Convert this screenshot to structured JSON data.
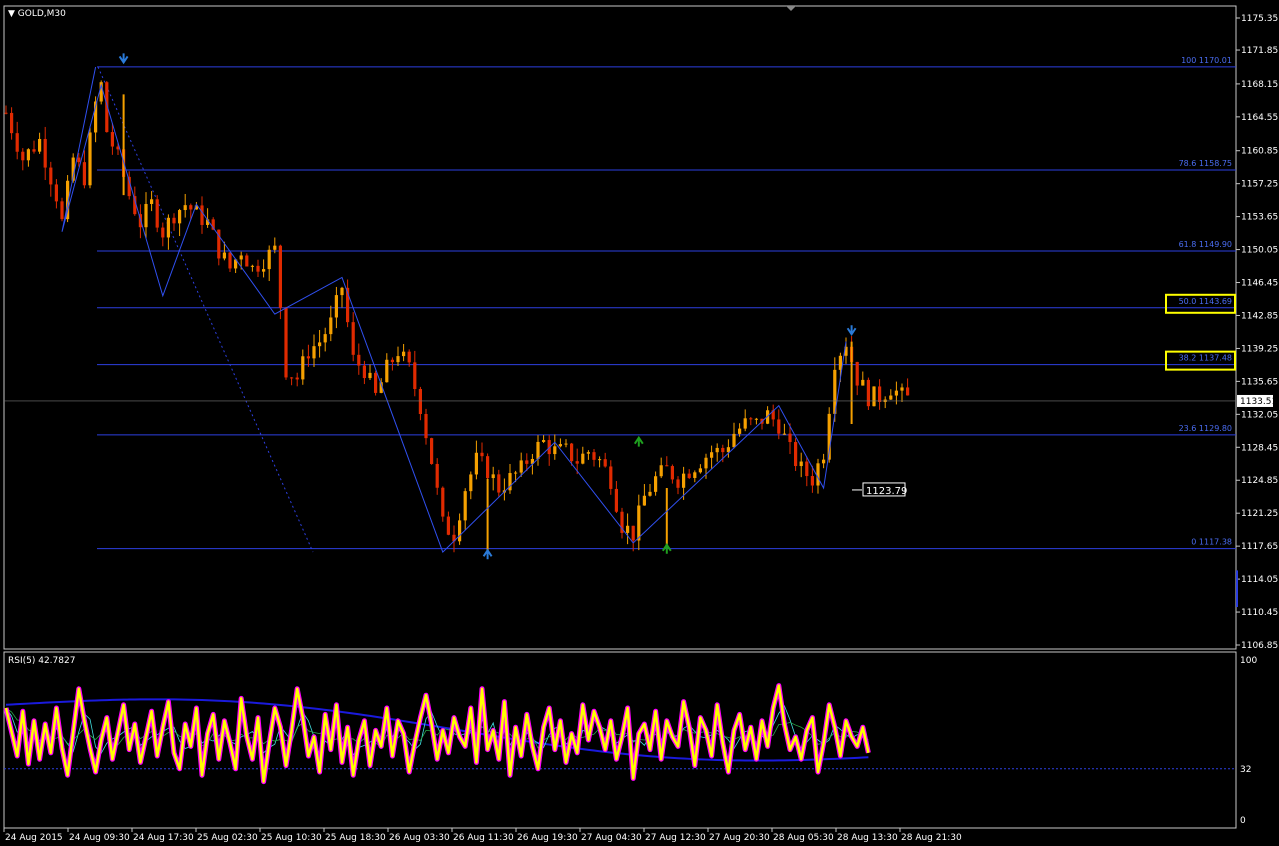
{
  "header": {
    "symbol_label": "GOLD,M30",
    "menu_glyph": "▼"
  },
  "colors": {
    "background": "#000000",
    "axis": "#c8c8c8",
    "grid": "#3a3a3a",
    "fib": "#2d3fe0",
    "fib_text": "#4a6cf0",
    "candle_up": "#f5a000",
    "candle_down": "#e02a00",
    "zigzag": "#3050f0",
    "rsi": "#ffff00",
    "rsi_glow": "#ff00ff",
    "ma_slow": "#1a1adc",
    "highlight_box": "#ffff00"
  },
  "price_axis": {
    "ticks": [
      "1175.35",
      "1171.85",
      "1168.15",
      "1164.55",
      "1160.85",
      "1157.25",
      "1153.65",
      "1150.05",
      "1146.45",
      "1142.85",
      "1139.25",
      "1135.65",
      "1132.05",
      "1128.45",
      "1124.85",
      "1121.25",
      "1117.65",
      "1114.05",
      "1110.45",
      "1106.85"
    ],
    "current_price": "1133.51",
    "marked_price": "1123.79"
  },
  "fibonacci": [
    {
      "label": "100 1170.01",
      "level": 1170.01,
      "highlight": false
    },
    {
      "label": "78.6 1158.75",
      "level": 1158.75,
      "highlight": false
    },
    {
      "label": "61.8 1149.90",
      "level": 1149.9,
      "highlight": false
    },
    {
      "label": "50.0 1143.69",
      "level": 1143.69,
      "highlight": true
    },
    {
      "label": "38.2 1137.48",
      "level": 1137.48,
      "highlight": true
    },
    {
      "label": "23.6 1129.80",
      "level": 1129.8,
      "highlight": false
    },
    {
      "label": "0 1117.38",
      "level": 1117.38,
      "highlight": false
    }
  ],
  "rsi": {
    "title": "RSI(5) 42.7827",
    "ticks": [
      "100",
      "32",
      "0"
    ],
    "level": 32
  },
  "time_axis": {
    "ticks": [
      "24 Aug 2015",
      "24 Aug 09:30",
      "24 Aug 17:30",
      "25 Aug 02:30",
      "25 Aug 10:30",
      "25 Aug 18:30",
      "26 Aug 03:30",
      "26 Aug 11:30",
      "26 Aug 19:30",
      "27 Aug 04:30",
      "27 Aug 12:30",
      "27 Aug 20:30",
      "28 Aug 05:30",
      "28 Aug 13:30",
      "28 Aug 21:30"
    ]
  },
  "chart_data": {
    "type": "candlestick",
    "title": "GOLD,M30",
    "ylim": [
      1106.0,
      1177.0
    ],
    "close_path": [
      [
        0,
        1165
      ],
      [
        3,
        1160
      ],
      [
        6,
        1162
      ],
      [
        9,
        1156
      ],
      [
        10,
        1153
      ],
      [
        12,
        1160
      ],
      [
        14,
        1158
      ],
      [
        16,
        1166
      ],
      [
        17,
        1168
      ],
      [
        18,
        1163
      ],
      [
        20,
        1160
      ],
      [
        22,
        1156
      ],
      [
        24,
        1153
      ],
      [
        26,
        1155
      ],
      [
        28,
        1152
      ],
      [
        30,
        1154
      ],
      [
        32,
        1155
      ],
      [
        34,
        1154
      ],
      [
        36,
        1153
      ],
      [
        38,
        1150
      ],
      [
        40,
        1148
      ],
      [
        42,
        1150
      ],
      [
        44,
        1148
      ],
      [
        46,
        1149
      ],
      [
        48,
        1150
      ],
      [
        49,
        1144
      ],
      [
        50,
        1137
      ],
      [
        52,
        1136
      ],
      [
        54,
        1139
      ],
      [
        56,
        1140
      ],
      [
        58,
        1142
      ],
      [
        60,
        1146
      ],
      [
        62,
        1138
      ],
      [
        64,
        1137
      ],
      [
        66,
        1134
      ],
      [
        68,
        1137
      ],
      [
        70,
        1139
      ],
      [
        72,
        1137
      ],
      [
        74,
        1133
      ],
      [
        76,
        1127
      ],
      [
        78,
        1120
      ],
      [
        80,
        1119
      ],
      [
        82,
        1124
      ],
      [
        84,
        1127
      ],
      [
        86,
        1126
      ],
      [
        88,
        1124
      ],
      [
        90,
        1125
      ],
      [
        92,
        1126
      ],
      [
        94,
        1128
      ],
      [
        96,
        1129
      ],
      [
        98,
        1128
      ],
      [
        100,
        1128
      ],
      [
        102,
        1127
      ],
      [
        104,
        1128
      ],
      [
        106,
        1127
      ],
      [
        108,
        1125
      ],
      [
        110,
        1120
      ],
      [
        112,
        1119
      ],
      [
        114,
        1123
      ],
      [
        116,
        1125
      ],
      [
        118,
        1126
      ],
      [
        120,
        1125
      ],
      [
        122,
        1126
      ],
      [
        124,
        1127
      ],
      [
        126,
        1128
      ],
      [
        128,
        1128
      ],
      [
        130,
        1130
      ],
      [
        132,
        1131
      ],
      [
        134,
        1131
      ],
      [
        136,
        1132
      ],
      [
        138,
        1131
      ],
      [
        140,
        1128
      ],
      [
        142,
        1126
      ],
      [
        144,
        1125
      ],
      [
        146,
        1128
      ],
      [
        148,
        1138
      ],
      [
        150,
        1140
      ],
      [
        152,
        1136
      ],
      [
        154,
        1134
      ],
      [
        156,
        1134
      ],
      [
        158,
        1135
      ],
      [
        160,
        1134
      ],
      [
        162,
        1133.5
      ]
    ],
    "zigzag": [
      [
        16,
        1170
      ],
      [
        10,
        1152
      ],
      [
        17,
        1168
      ],
      [
        28,
        1145
      ],
      [
        34,
        1155
      ],
      [
        48,
        1143
      ],
      [
        60,
        1147
      ],
      [
        78,
        1117
      ],
      [
        98,
        1129
      ],
      [
        112,
        1118
      ],
      [
        138,
        1133
      ],
      [
        146,
        1124
      ],
      [
        150,
        1140
      ]
    ],
    "arrows": [
      {
        "bar": 21,
        "price": 1170.5,
        "dir": "down",
        "color": "blue"
      },
      {
        "bar": 86,
        "price": 1117.2,
        "dir": "up",
        "color": "blue"
      },
      {
        "bar": 113,
        "price": 1129.5,
        "dir": "up",
        "color": "green"
      },
      {
        "bar": 118,
        "price": 1117.8,
        "dir": "up",
        "color": "green"
      },
      {
        "bar": 151,
        "price": 1140.8,
        "dir": "down",
        "color": "blue"
      }
    ],
    "rsi_series": {
      "name": "RSI(5)",
      "values": [
        70,
        55,
        40,
        68,
        35,
        62,
        38,
        60,
        42,
        70,
        45,
        28,
        55,
        82,
        62,
        45,
        30,
        50,
        64,
        38,
        55,
        72,
        44,
        60,
        36,
        52,
        68,
        40,
        58,
        74,
        42,
        32,
        60,
        46,
        70,
        28,
        54,
        66,
        38,
        62,
        48,
        32,
        76,
        52,
        38,
        64,
        24,
        48,
        70,
        58,
        34,
        56,
        82,
        64,
        40,
        52,
        30,
        66,
        44,
        72,
        36,
        58,
        28,
        50,
        62,
        34,
        56,
        46,
        70,
        40,
        62,
        54,
        30,
        48,
        64,
        78,
        60,
        38,
        56,
        42,
        64,
        52,
        46,
        70,
        36,
        82,
        44,
        56,
        38,
        74,
        28,
        58,
        40,
        66,
        46,
        32,
        58,
        70,
        44,
        62,
        36,
        54,
        42,
        72,
        50,
        68,
        58,
        44,
        62,
        38,
        52,
        70,
        26,
        54,
        60,
        44,
        68,
        38,
        62,
        52,
        46,
        74,
        58,
        34,
        64,
        56,
        40,
        72,
        48,
        30,
        56,
        66,
        44,
        58,
        38,
        62,
        46,
        70,
        84,
        60,
        44,
        52,
        38,
        56,
        64,
        30,
        48,
        72,
        58,
        40,
        62,
        52,
        46,
        58,
        42
      ]
    }
  }
}
